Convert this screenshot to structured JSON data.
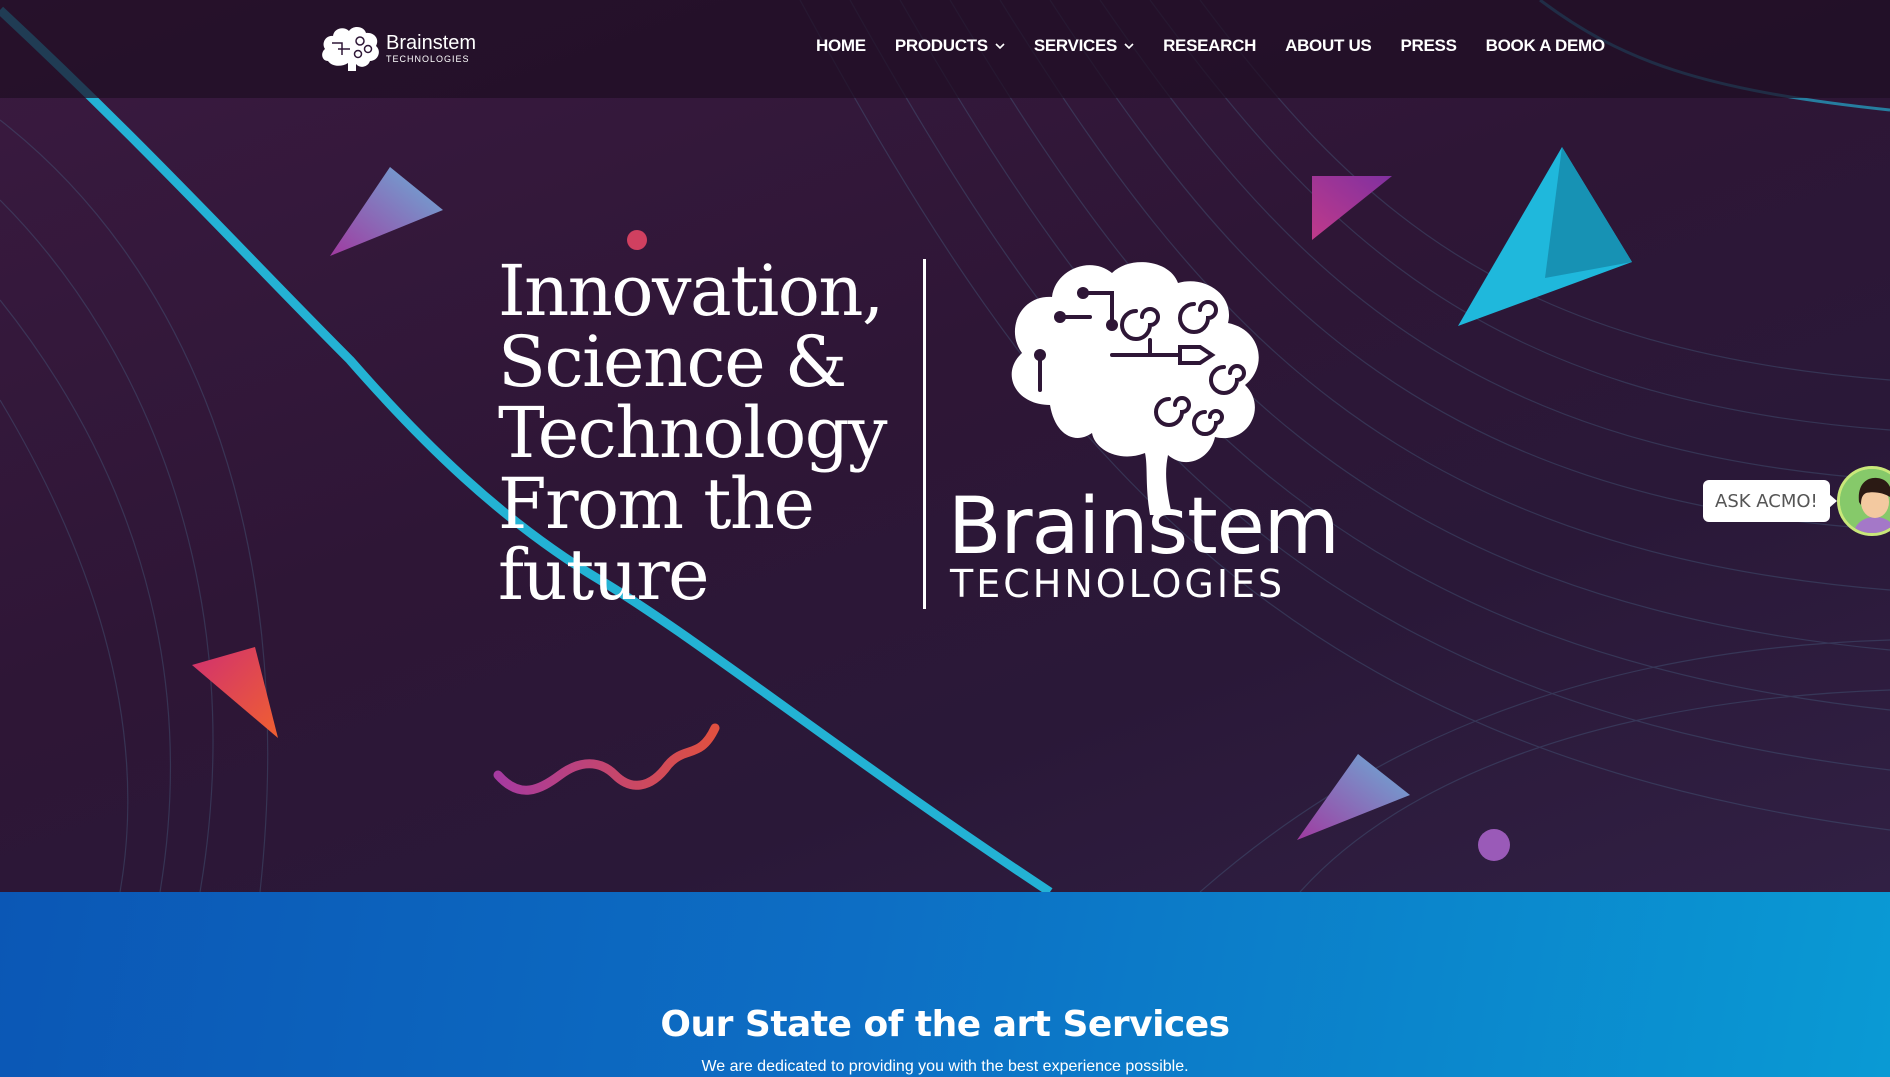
{
  "brand": {
    "name": "Brainstem",
    "sub": "TECHNOLOGIES"
  },
  "nav": {
    "items": [
      {
        "label": "HOME"
      },
      {
        "label": "PRODUCTS"
      },
      {
        "label": "SERVICES"
      },
      {
        "label": "RESEARCH"
      },
      {
        "label": "ABOUT US"
      },
      {
        "label": "PRESS"
      },
      {
        "label": "BOOK A DEMO"
      }
    ]
  },
  "hero": {
    "tagline": [
      "Innovation,",
      "Science &",
      "Technology",
      "From the",
      "future"
    ],
    "logo_name": "Brainstem",
    "logo_sub": "TECHNOLOGIES"
  },
  "chat": {
    "label": "ASK ACMO!"
  },
  "services": {
    "title": "Our State of the art Services",
    "subtitle": "We are dedicated to providing you with the best experience possible."
  },
  "colors": {
    "hero_bg": "#2e1636",
    "accent_cyan": "#22c3e6",
    "services_blue": "#0b6ec4"
  }
}
